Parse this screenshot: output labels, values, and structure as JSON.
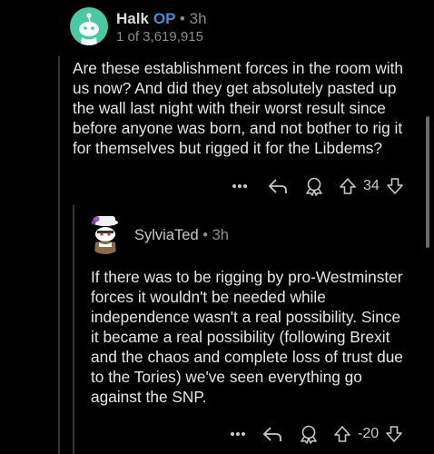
{
  "comment": {
    "author": "Halk",
    "op_badge": "OP",
    "separator": "•",
    "time": "3h",
    "position_text": "1 of 3,619,915",
    "body": "Are these establishment forces in the room with us now? And did they get absolutely pasted up the wall last night with their worst result since before anyone was born, and not bother to rig it for themselves but rigged it for the Libdems?",
    "more_icon": "more-dots-icon",
    "reply_icon": "reply-arrow-icon",
    "award_icon": "award-icon",
    "upvote_icon": "upvote-icon",
    "downvote_icon": "downvote-icon",
    "score": "34"
  },
  "reply": {
    "author": "SylviaTed",
    "separator": "•",
    "time": "3h",
    "body": "If there was to be rigging by pro-Westminster forces it wouldn't be needed while independence wasn't a real possibility. Since it became a real possibility (following Brexit and the chaos and complete loss of trust due to the Tories) we've seen everything go against the SNP.",
    "score": "-20"
  },
  "colors": {
    "background": "#000000",
    "op_badge": "#3f8fd8",
    "avatar_bg": "#48c9a3",
    "thread_line": "#343536"
  }
}
